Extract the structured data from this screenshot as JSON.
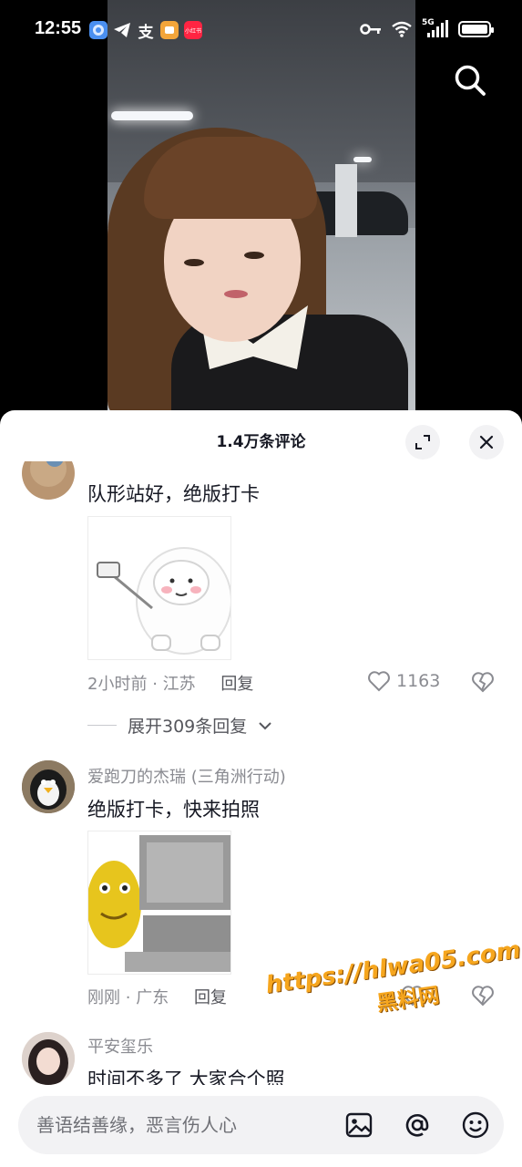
{
  "status_bar": {
    "time": "12:55",
    "network": "5G",
    "app_icons": [
      "browser-app-icon",
      "telegram-icon",
      "alipay-icon",
      "app-icon",
      "xiaohongshu-icon"
    ],
    "xiaohongshu_label": "小红书",
    "alipay_glyph": "支"
  },
  "video": {
    "search_icon": "search-icon"
  },
  "comments_panel": {
    "title": "1.4万条评论",
    "expand_icon": "expand-icon",
    "close_icon": "close-icon",
    "comments": [
      {
        "author": "",
        "text": "队形站好，绝版打卡",
        "sticker": "bunny-selfie-sticker",
        "time": "2小时前",
        "location": "江苏",
        "reply_label": "回复",
        "likes": "1163",
        "replies_label": "展开309条回复"
      },
      {
        "author": "爱跑刀的杰瑞 (三角洲行动)",
        "text": "绝版打卡，快来拍照",
        "sticker": "yellow-character-computer-sticker",
        "time": "刚刚",
        "location": "广东",
        "reply_label": "回复"
      },
      {
        "author": "平安玺乐",
        "text": "时间不多了 大家合个照"
      }
    ],
    "meta_separator": "·"
  },
  "watermark": {
    "url": "https://hlwa05.com",
    "name": "黑料网"
  },
  "input": {
    "placeholder": "善语结善缘，恶言伤人心"
  }
}
